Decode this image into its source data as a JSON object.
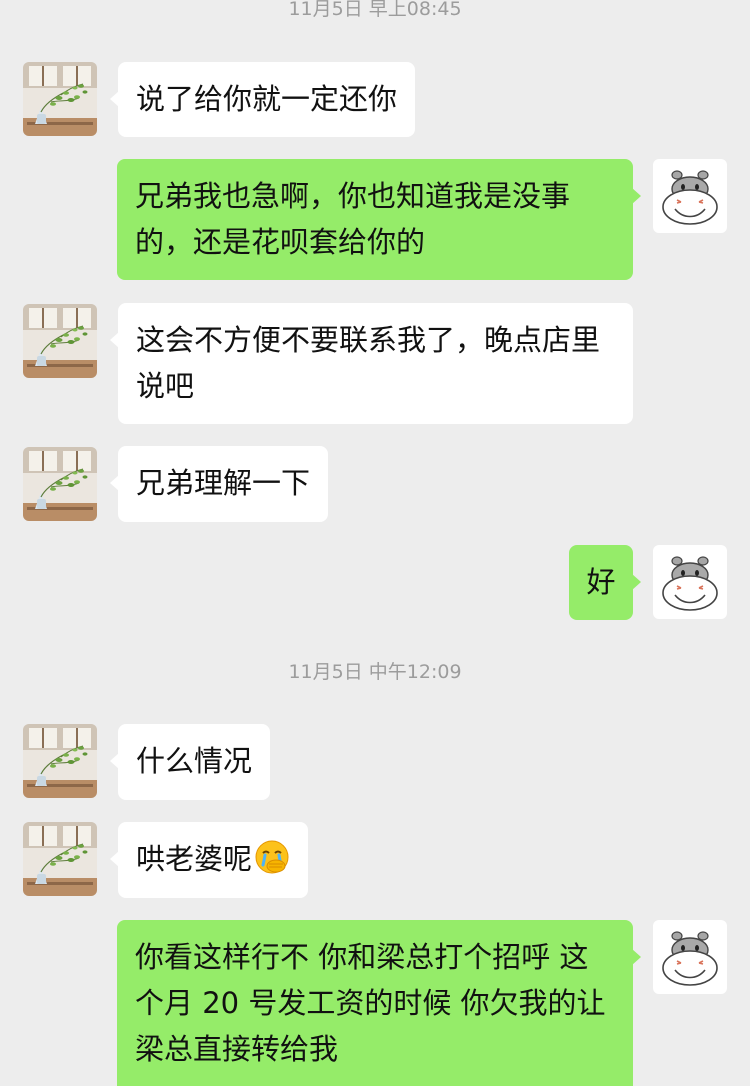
{
  "colors": {
    "background": "#ededed",
    "incoming_bubble": "#ffffff",
    "outgoing_bubble": "#95ec69",
    "timestamp_text": "#9c9c9c"
  },
  "contact_avatar_icon": "plant-by-window-photo",
  "self_avatar_icon": "hippo-face",
  "timestamps": [
    "11月5日 早上08:45",
    "11月5日 中午12:09"
  ],
  "messages": [
    {
      "side": "incoming",
      "text": "说了给你就一定还你"
    },
    {
      "side": "outgoing",
      "text": "兄弟我也急啊，你也知道我是没事的，还是花呗套给你的"
    },
    {
      "side": "incoming",
      "text": "这会不方便不要联系我了，晚点店里说吧"
    },
    {
      "side": "incoming",
      "text": "兄弟理解一下"
    },
    {
      "side": "outgoing",
      "text": "好"
    },
    {
      "side": "incoming",
      "text": "什么情况"
    },
    {
      "side": "incoming",
      "text": "哄老婆呢",
      "emoji": "face-with-hand-over-mouth-crying-emoji"
    },
    {
      "side": "outgoing",
      "text": "你看这样行不 你和梁总打个招呼 这个月 20 号发工资的时候 你欠我的让梁总直接转给我"
    }
  ]
}
